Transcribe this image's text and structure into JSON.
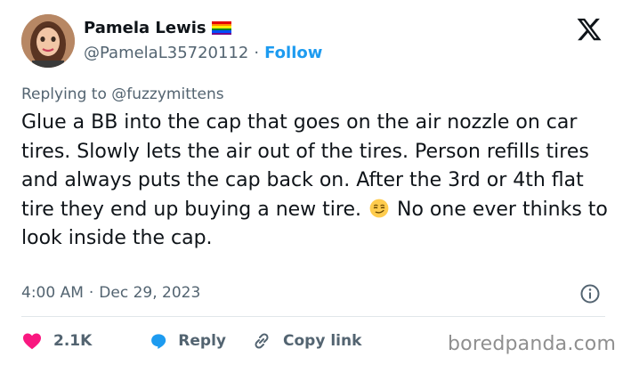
{
  "author": {
    "display_name": "Pamela Lewis",
    "handle": "@PamelaL35720112",
    "separator": "·",
    "follow_label": "Follow",
    "flag_colors": [
      "#e40303",
      "#ff8c00",
      "#ffed00",
      "#008026",
      "#004dff",
      "#750787"
    ]
  },
  "reply_context": {
    "prefix": "Replying to",
    "mention": "@fuzzymittens"
  },
  "tweet": {
    "text_before_emoji": "Glue a BB into the cap that goes on the air nozzle on car tires. Slowly lets the air out of the tires. Person refills tires and always puts the cap back on. After the 3rd or 4th flat tire they end up buying a new tire.",
    "emoji": "smirking-face",
    "text_after_emoji": "No one ever thinks to look inside the cap."
  },
  "meta": {
    "time": "4:00 AM",
    "separator": "·",
    "date": "Dec 29, 2023"
  },
  "actions": {
    "like_count": "2.1K",
    "reply_label": "Reply",
    "copy_link_label": "Copy link"
  },
  "colors": {
    "accent": "#1d9bf0",
    "like": "#f91880",
    "text": "#0f1419",
    "secondary": "#536471"
  },
  "watermark": "boredpanda.com"
}
